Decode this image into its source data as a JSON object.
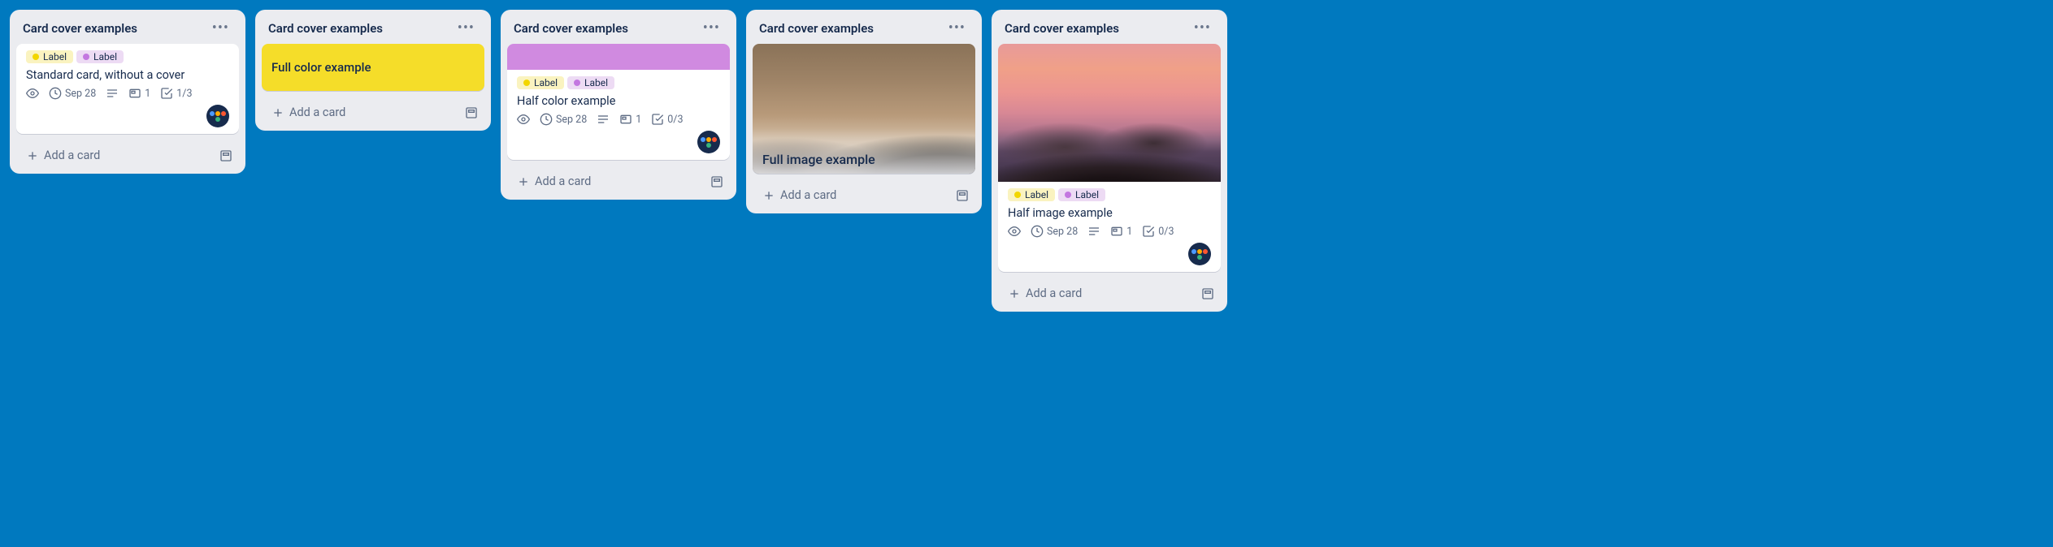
{
  "list_title": "Card cover examples",
  "add_card_label": "Add a card",
  "label_text": "Label",
  "lists": [
    {
      "card": {
        "title": "Standard card, without a cover",
        "labels": [
          "yellow",
          "purple"
        ],
        "badges": {
          "watch": true,
          "due": "Sep 28",
          "description": true,
          "attachments": "1",
          "checklist": "1/3"
        },
        "member": true
      }
    },
    {
      "card": {
        "full_color": "#f5dd29",
        "title": "Full color example"
      }
    },
    {
      "card": {
        "half_color": "#d08ae0",
        "title": "Half color example",
        "labels": [
          "yellow",
          "purple"
        ],
        "badges": {
          "watch": true,
          "due": "Sep 28",
          "description": true,
          "attachments": "1",
          "checklist": "0/3"
        },
        "member": true
      }
    },
    {
      "card": {
        "full_image": "dark",
        "title": "Full image example"
      }
    },
    {
      "card": {
        "half_image": "sunset",
        "title": "Half image example",
        "labels": [
          "yellow",
          "purple"
        ],
        "badges": {
          "watch": true,
          "due": "Sep 28",
          "description": true,
          "attachments": "1",
          "checklist": "0/3"
        },
        "member": true
      }
    }
  ]
}
